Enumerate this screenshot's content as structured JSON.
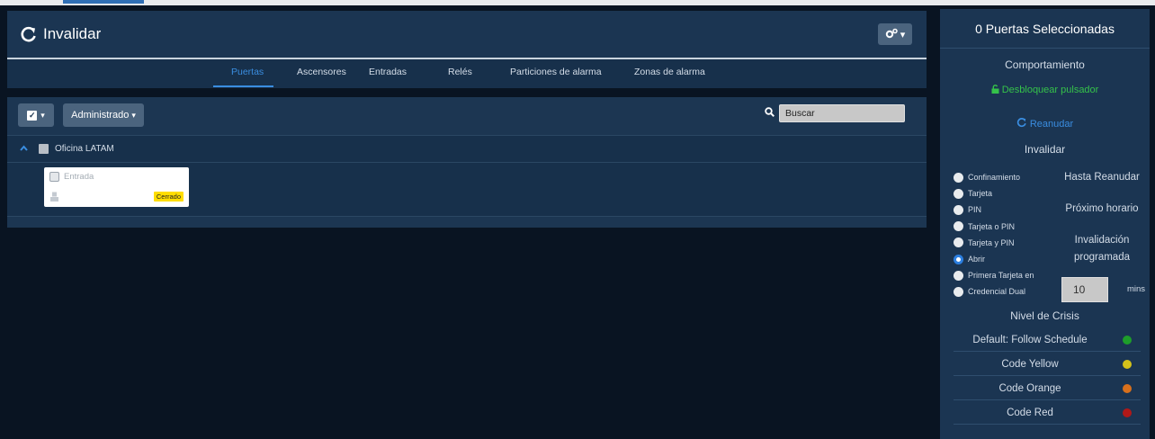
{
  "header": {
    "title": "Invalidar"
  },
  "tabs": [
    {
      "label": "Puertas",
      "active": true
    },
    {
      "label": "Ascensores",
      "active": false
    },
    {
      "label": "Entradas",
      "active": false
    },
    {
      "label": "Relés",
      "active": false
    },
    {
      "label": "Particiones de alarma",
      "active": false
    },
    {
      "label": "Zonas de alarma",
      "active": false
    }
  ],
  "toolbar": {
    "filter_label": "Administrado",
    "search_placeholder": "Buscar"
  },
  "group": {
    "label": "Oficina LATAM"
  },
  "door": {
    "name": "Entrada",
    "status": "Cerrado",
    "status_color": "#ffdd00"
  },
  "panel": {
    "title": "0 Puertas Seleccionadas",
    "behavior_label": "Comportamiento",
    "unlock_label": "Desbloquear pulsador",
    "resume_label": "Reanudar",
    "override_label": "Invalidar",
    "modes": [
      {
        "label": "Confinamiento",
        "selected": false
      },
      {
        "label": "Tarjeta",
        "selected": false
      },
      {
        "label": "PIN",
        "selected": false
      },
      {
        "label": "Tarjeta o PIN",
        "selected": false
      },
      {
        "label": "Tarjeta y PIN",
        "selected": false
      },
      {
        "label": "Abrir",
        "selected": true
      },
      {
        "label": "Primera Tarjeta en",
        "selected": false
      },
      {
        "label": "Credencial Dual",
        "selected": false
      }
    ],
    "until_resume": "Hasta Reanudar",
    "next_schedule": "Próximo horario",
    "scheduled_override_1": "Invalidación",
    "scheduled_override_2": "programada",
    "minutes_value": "10",
    "minutes_unit": "mins",
    "crisis_label": "Nivel de Crisis",
    "crisis_levels": [
      {
        "label": "Default: Follow Schedule",
        "color": "#1e9e2a"
      },
      {
        "label": "Code Yellow",
        "color": "#d4c21a"
      },
      {
        "label": "Code Orange",
        "color": "#d8701c"
      },
      {
        "label": "Code Red",
        "color": "#b01818"
      }
    ]
  },
  "colors": {
    "accent": "#3a8de0",
    "panel_bg": "#1b3552",
    "page_bg": "#091422"
  }
}
